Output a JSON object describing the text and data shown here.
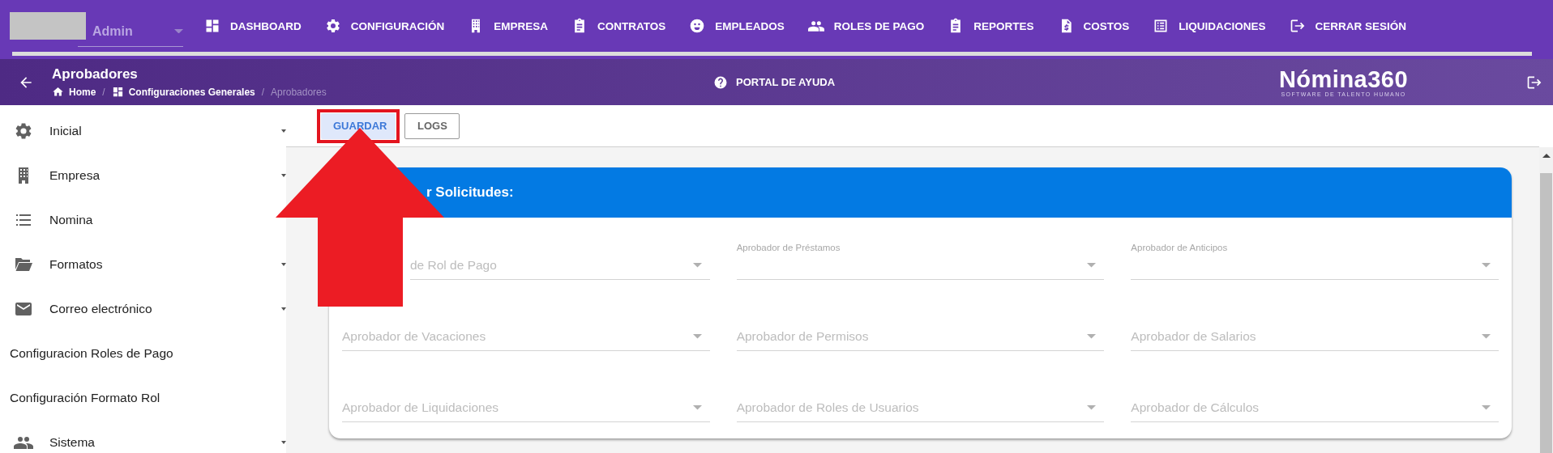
{
  "user_select": {
    "value": "Admin"
  },
  "nav": [
    {
      "label": "DASHBOARD",
      "kind": "dashboard"
    },
    {
      "label": "CONFIGURACIÓN",
      "kind": "gear"
    },
    {
      "label": "EMPRESA",
      "kind": "building"
    },
    {
      "label": "CONTRATOS",
      "kind": "clipboard"
    },
    {
      "label": "EMPLEADOS",
      "kind": "smiley"
    },
    {
      "label": "ROLES DE PAGO",
      "kind": "people"
    },
    {
      "label": "REPORTES",
      "kind": "clipboard"
    },
    {
      "label": "COSTOS",
      "kind": "dollar"
    },
    {
      "label": "LIQUIDACIONES",
      "kind": "listalt"
    },
    {
      "label": "CERRAR SESIÓN",
      "kind": "logout"
    }
  ],
  "page_header": {
    "title": "Aprobadores",
    "breadcrumbs": [
      {
        "label": "Home",
        "kind": "home"
      },
      {
        "label": "Configuraciones Generales",
        "kind": "dashboard"
      },
      {
        "label": "Aprobadores",
        "kind": "current"
      }
    ],
    "separator": "/",
    "help": "PORTAL DE AYUDA",
    "logo": {
      "name": "Nómina360",
      "tagline": "SOFTWARE DE TALENTO HUMANO"
    }
  },
  "sidebar": {
    "items": [
      {
        "label": "Inicial",
        "kind": "gear",
        "expandable": true
      },
      {
        "label": "Empresa",
        "kind": "building",
        "expandable": true
      },
      {
        "label": "Nomina",
        "kind": "list",
        "expandable": false
      },
      {
        "label": "Formatos",
        "kind": "folder",
        "expandable": true
      },
      {
        "label": "Correo electrónico",
        "kind": "mail",
        "expandable": true
      },
      {
        "label": "Configuracion Roles de Pago",
        "kind": "none",
        "expandable": false
      },
      {
        "label": "Configuración Formato Rol",
        "kind": "none",
        "expandable": false
      },
      {
        "label": "Sistema",
        "kind": "people",
        "expandable": true
      }
    ]
  },
  "toolbar": [
    {
      "label": "GUARDAR",
      "kind": "primary",
      "annotated": true
    },
    {
      "label": "LOGS",
      "kind": "outlined",
      "annotated": false
    }
  ],
  "card": {
    "title": "r Solicitudes:",
    "fields": [
      {
        "label": "de Rol de Pago",
        "floating": false,
        "obscured": true
      },
      {
        "label": "Aprobador de Préstamos",
        "floating": true,
        "obscured": false
      },
      {
        "label": "Aprobador de Anticipos",
        "floating": true,
        "obscured": false
      },
      {
        "label": "Aprobador de Vacaciones",
        "floating": false,
        "obscured": false
      },
      {
        "label": "Aprobador de Permisos",
        "floating": false,
        "obscured": false
      },
      {
        "label": "Aprobador de Salarios",
        "floating": false,
        "obscured": false
      },
      {
        "label": "Aprobador de Liquidaciones",
        "floating": false,
        "obscured": false
      },
      {
        "label": "Aprobador de Roles de Usuarios",
        "floating": false,
        "obscured": false
      },
      {
        "label": "Aprobador de Cálculos",
        "floating": false,
        "obscured": false
      }
    ]
  }
}
